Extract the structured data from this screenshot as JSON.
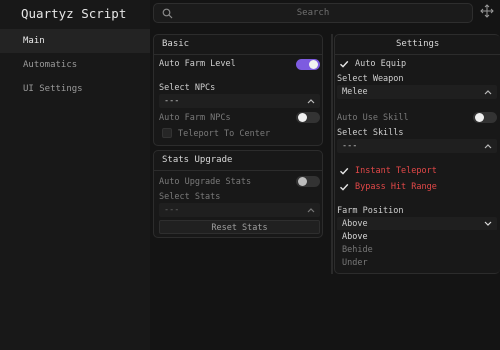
{
  "app": {
    "title": "Quartyz Script"
  },
  "sidebar": {
    "items": [
      {
        "label": "Main"
      },
      {
        "label": "Automatics"
      },
      {
        "label": "UI Settings"
      }
    ]
  },
  "search": {
    "placeholder": "Search"
  },
  "basic": {
    "title": "Basic",
    "auto_farm_level": {
      "label": "Auto Farm Level",
      "on": true
    },
    "select_npcs": {
      "label": "Select NPCs",
      "value": "---"
    },
    "auto_farm_npcs": {
      "label": "Auto Farm NPCs",
      "on": false
    },
    "teleport_to_center": {
      "label": "Teleport To Center",
      "checked": false
    }
  },
  "stats": {
    "title": "Stats Upgrade",
    "auto_upgrade_stats": {
      "label": "Auto Upgrade Stats",
      "on": false
    },
    "select_stats": {
      "label": "Select Stats",
      "value": "---"
    },
    "reset_stats": {
      "label": "Reset Stats"
    }
  },
  "settings": {
    "title": "Settings",
    "auto_equip": {
      "label": "Auto Equip",
      "checked": true
    },
    "select_weapon": {
      "label": "Select Weapon",
      "value": "Melee"
    },
    "auto_use_skill": {
      "label": "Auto Use Skill",
      "on": false
    },
    "select_skills": {
      "label": "Select Skills",
      "value": "---"
    },
    "instant_teleport": {
      "label": "Instant Teleport",
      "checked": true
    },
    "bypass_hit_range": {
      "label": "Bypass Hit Range",
      "checked": true
    },
    "farm_position": {
      "label": "Farm Position",
      "value": "Above",
      "options": [
        {
          "label": "Above"
        },
        {
          "label": "Behide"
        },
        {
          "label": "Under"
        }
      ]
    }
  },
  "colors": {
    "accent": "#7d5be0",
    "warning_text": "#e24848",
    "background": "#141414"
  }
}
